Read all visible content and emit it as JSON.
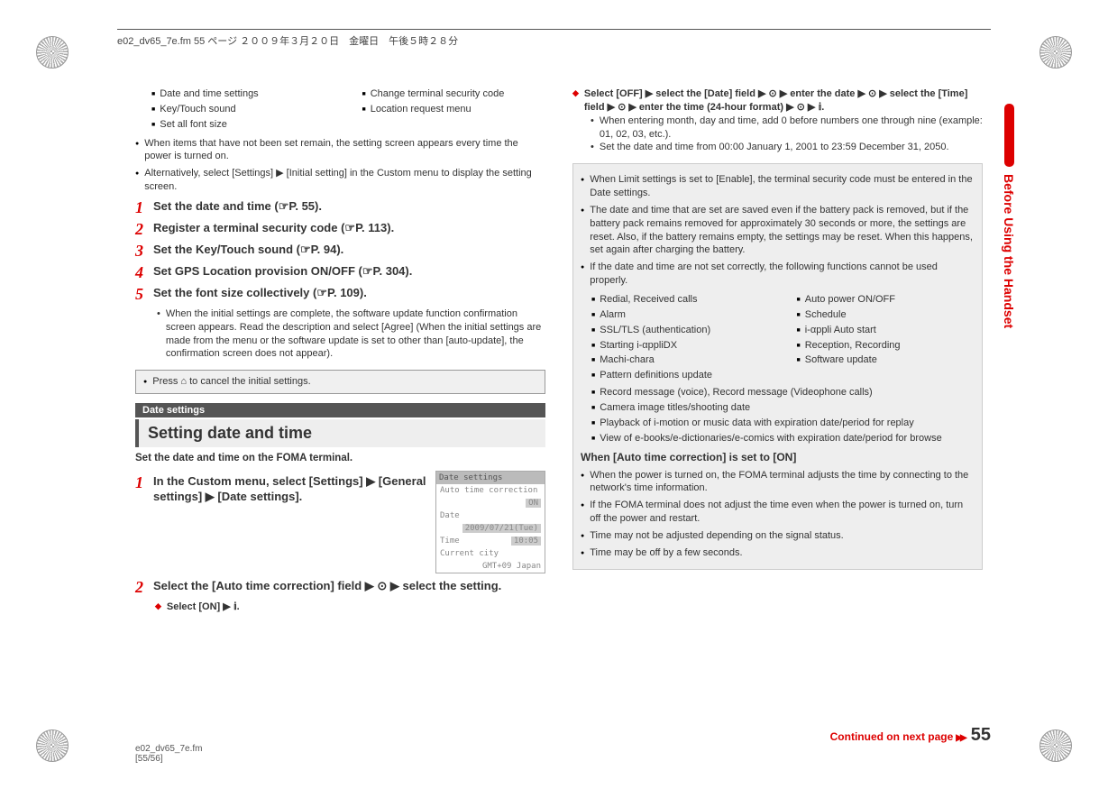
{
  "header": "e02_dv65_7e.fm  55 ページ  ２００９年３月２０日　金曜日　午後５時２８分",
  "sideTab": "Before Using the Handset",
  "footer": {
    "file": "e02_dv65_7e.fm",
    "pos": "[55/56]"
  },
  "continued": "Continued on next page",
  "pageNumber": "55",
  "left": {
    "topSettingsA": [
      "Date and time settings",
      "Key/Touch sound",
      "Set all font size"
    ],
    "topSettingsB": [
      "Change terminal security code",
      "Location request menu"
    ],
    "topDots": [
      "When items that have not been set remain, the setting screen appears every time the power is turned on.",
      "Alternatively, select [Settings] ▶ [Initial setting] in the Custom menu to display the setting screen."
    ],
    "steps": [
      "Set the date and time (☞P. 55).",
      "Register a terminal security code (☞P. 113).",
      "Set the Key/Touch sound (☞P. 94).",
      "Set GPS Location provision ON/OFF (☞P. 304).",
      "Set the font size collectively (☞P. 109)."
    ],
    "stepNote": "When the initial settings are complete, the software update function confirmation screen appears. Read the description and select [Agree] (When the initial settings are made from the menu or the software update is set to other than [auto-update], the confirmation screen does not appear).",
    "noteBox": "Press ⌂ to cancel the initial settings.",
    "subsection": "Date settings",
    "sectionTitle": "Setting date and time",
    "intro": "Set the date and time on the FOMA terminal.",
    "step1": "In the Custom menu, select [Settings] ▶ [General settings] ▶ [Date settings].",
    "step2": "Select the [Auto time correction] field ▶ ⊙ ▶ select the setting.",
    "diamond1": "Select [ON] ▶ 𝕚.",
    "phone": {
      "hdr": "Date settings",
      "rows": [
        {
          "l": "Auto time correction",
          "r": ""
        },
        {
          "l": "",
          "r": "ON"
        },
        {
          "l": "Date",
          "r": ""
        },
        {
          "l": "",
          "r": "2009/07/21(Tue)"
        },
        {
          "l": "Time",
          "r": "10:05"
        },
        {
          "l": "Current city",
          "r": ""
        },
        {
          "l": "",
          "r": "GMT+09 Japan"
        }
      ]
    }
  },
  "right": {
    "diamond2": "Select [OFF] ▶ select the [Date] field ▶ ⊙ ▶ enter the date ▶ ⊙ ▶ select the [Time] field ▶ ⊙ ▶ enter the time (24-hour format) ▶ ⊙ ▶ 𝕚.",
    "diamond2subs": [
      "When entering month, day and time, add 0 before numbers one through nine (example: 01, 02, 03, etc.).",
      "Set the date and time from 00:00 January 1, 2001 to 23:59 December 31, 2050."
    ],
    "grayDots": [
      "When Limit settings is set to [Enable], the terminal security code must be entered in the Date settings.",
      "The date and time that are set are saved even if the battery pack is removed, but if the battery pack remains removed for approximately 30 seconds or more, the settings are reset. Also, if the battery remains empty, the settings may be reset. When this happens, set again after charging the battery.",
      "If the date and time are not set correctly, the following functions cannot be used properly."
    ],
    "funcA": [
      "Redial, Received calls",
      "Alarm",
      "SSL/TLS (authentication)",
      "Starting i-αppliDX",
      "Machi-chara",
      "Pattern definitions update"
    ],
    "funcB": [
      "Auto power ON/OFF",
      "Schedule",
      "i-αppli Auto start",
      "Reception, Recording",
      "Software update"
    ],
    "funcFull": [
      "Record message (voice), Record message (Videophone calls)",
      "Camera image titles/shooting date",
      "Playback of i-motion or music data with expiration date/period for replay",
      "View of e-books/e-dictionaries/e-comics with expiration date/period for browse"
    ],
    "autoHead": "When [Auto time correction] is set to [ON]",
    "autoDots": [
      "When the power is turned on, the FOMA terminal adjusts the time by connecting to the network's time information.",
      "If the FOMA terminal does not adjust the time even when the power is turned on, turn off the power and restart.",
      "Time may not be adjusted depending on the signal status.",
      "Time may be off by a few seconds."
    ]
  }
}
